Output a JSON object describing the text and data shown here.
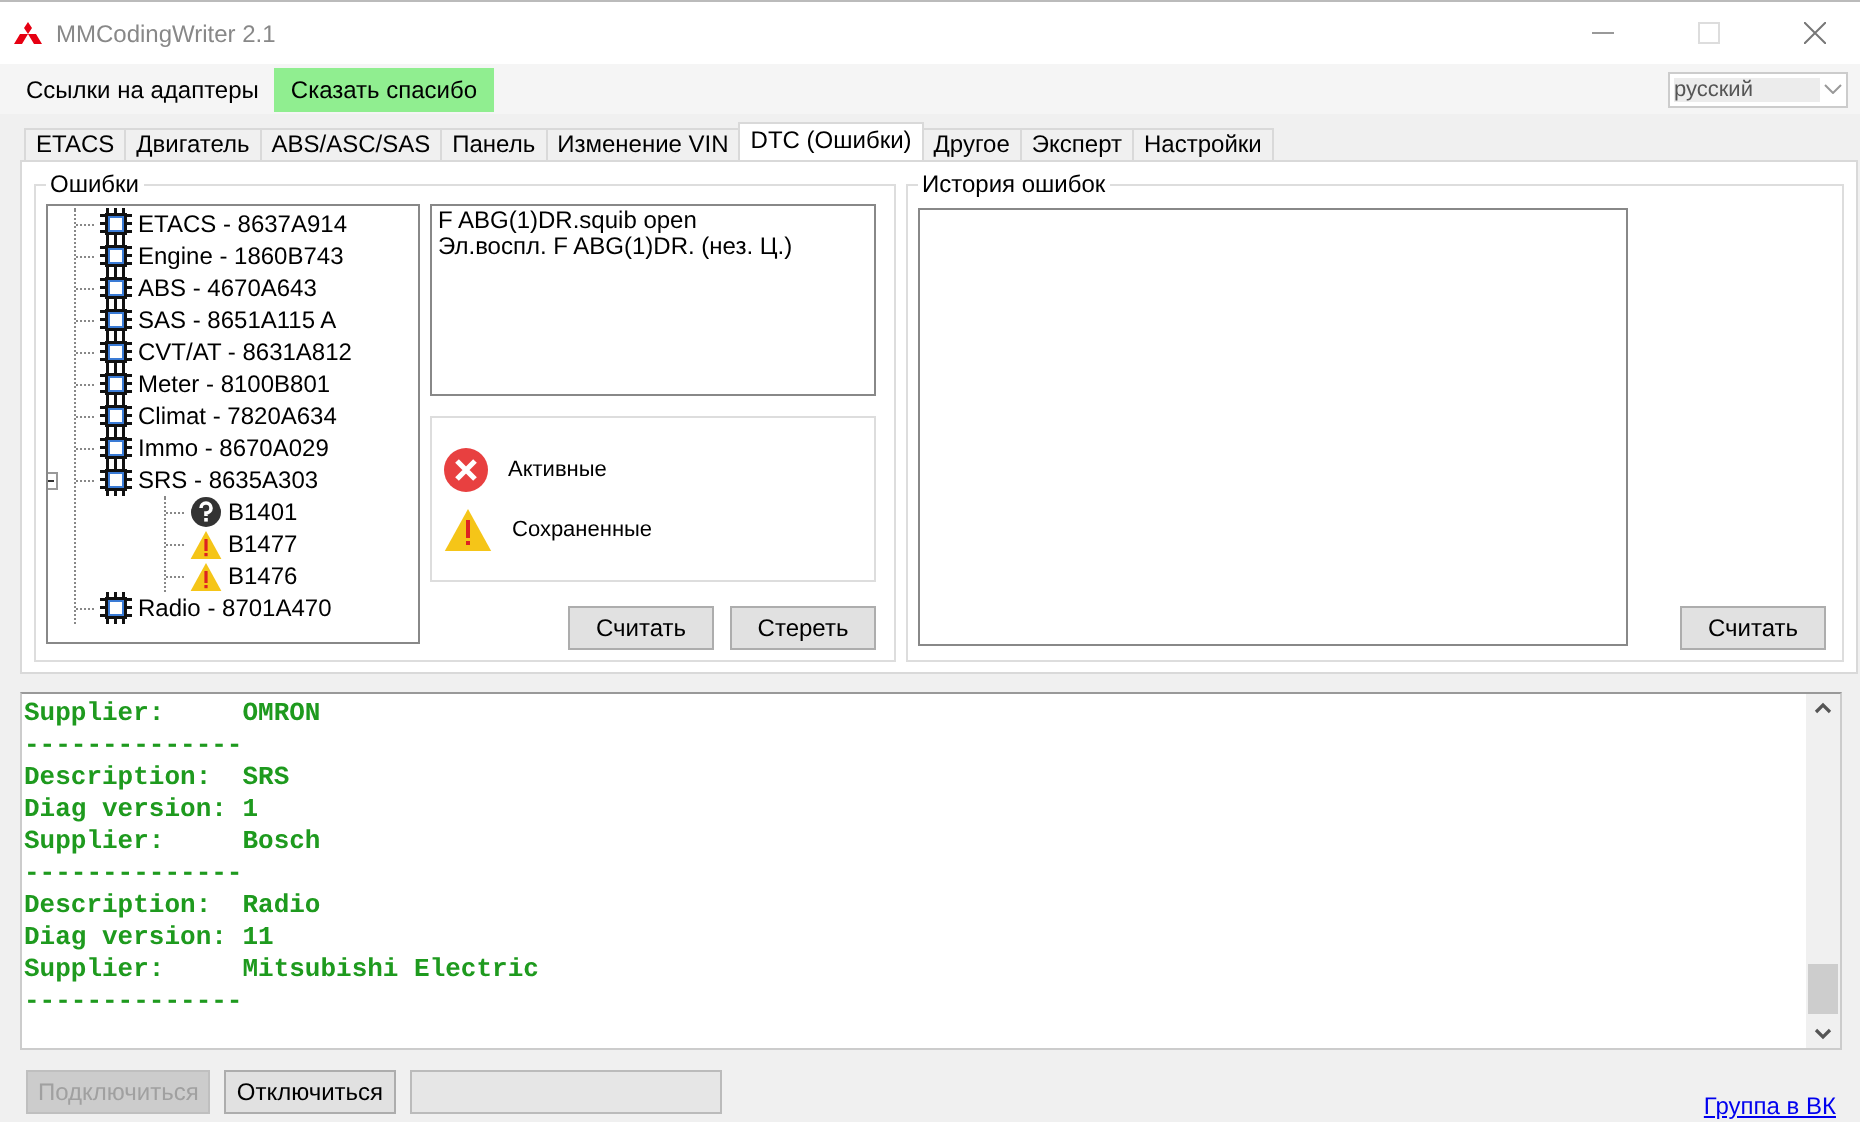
{
  "window": {
    "title": "MMCodingWriter 2.1"
  },
  "menu": [
    {
      "label": "Ссылки на адаптеры",
      "kind": "plain"
    },
    {
      "label": "Сказать спасибо",
      "kind": "highlight"
    }
  ],
  "language": {
    "value": "русский"
  },
  "tabs": [
    {
      "label": "ETACS",
      "selected": false
    },
    {
      "label": "Двигатель",
      "selected": false
    },
    {
      "label": "ABS/ASC/SAS",
      "selected": false
    },
    {
      "label": "Панель",
      "selected": false
    },
    {
      "label": "Изменение VIN",
      "selected": false
    },
    {
      "label": "DTC (Ошибки)",
      "selected": true
    },
    {
      "label": "Другое",
      "selected": false
    },
    {
      "label": "Эксперт",
      "selected": false
    },
    {
      "label": "Настройки",
      "selected": false
    }
  ],
  "errors_group": {
    "title": "Ошибки",
    "tree": [
      {
        "label": "ETACS - 8637A914",
        "kind": "module"
      },
      {
        "label": "Engine - 1860B743",
        "kind": "module"
      },
      {
        "label": "ABS - 4670A643",
        "kind": "module"
      },
      {
        "label": "SAS - 8651A115 A",
        "kind": "module"
      },
      {
        "label": "CVT/AT - 8631A812",
        "kind": "module"
      },
      {
        "label": "Meter - 8100B801",
        "kind": "module"
      },
      {
        "label": "Climat - 7820A634",
        "kind": "module"
      },
      {
        "label": "Immo - 8670A029",
        "kind": "module"
      },
      {
        "label": "SRS - 8635A303",
        "kind": "module",
        "expanded": true,
        "children": [
          {
            "label": "B1401",
            "kind": "unknown"
          },
          {
            "label": "B1477",
            "kind": "saved"
          },
          {
            "label": "B1476",
            "kind": "saved"
          }
        ]
      },
      {
        "label": "Radio - 8701A470",
        "kind": "module"
      }
    ],
    "details": [
      "F ABG(1)DR.squib open",
      "Эл.воспл. F ABG(1)DR. (нез. Ц.)"
    ],
    "legend": [
      {
        "label": "Активные",
        "kind": "active"
      },
      {
        "label": "Сохраненные",
        "kind": "saved"
      }
    ],
    "buttons": [
      "Считать",
      "Стереть"
    ]
  },
  "history_group": {
    "title": "История ошибок",
    "buttons": [
      "Считать"
    ]
  },
  "log": [
    "Supplier:     OMRON",
    "--------------",
    "Description:  SRS",
    "Diag version: 1",
    "Supplier:     Bosch",
    "--------------",
    "Description:  Radio",
    "Diag version: 11",
    "Supplier:     Mitsubishi Electric",
    "--------------"
  ],
  "bottom_buttons": [
    {
      "label": "Подключиться",
      "disabled": true
    },
    {
      "label": "Отключиться",
      "disabled": false
    }
  ],
  "link": "Группа в ВК"
}
